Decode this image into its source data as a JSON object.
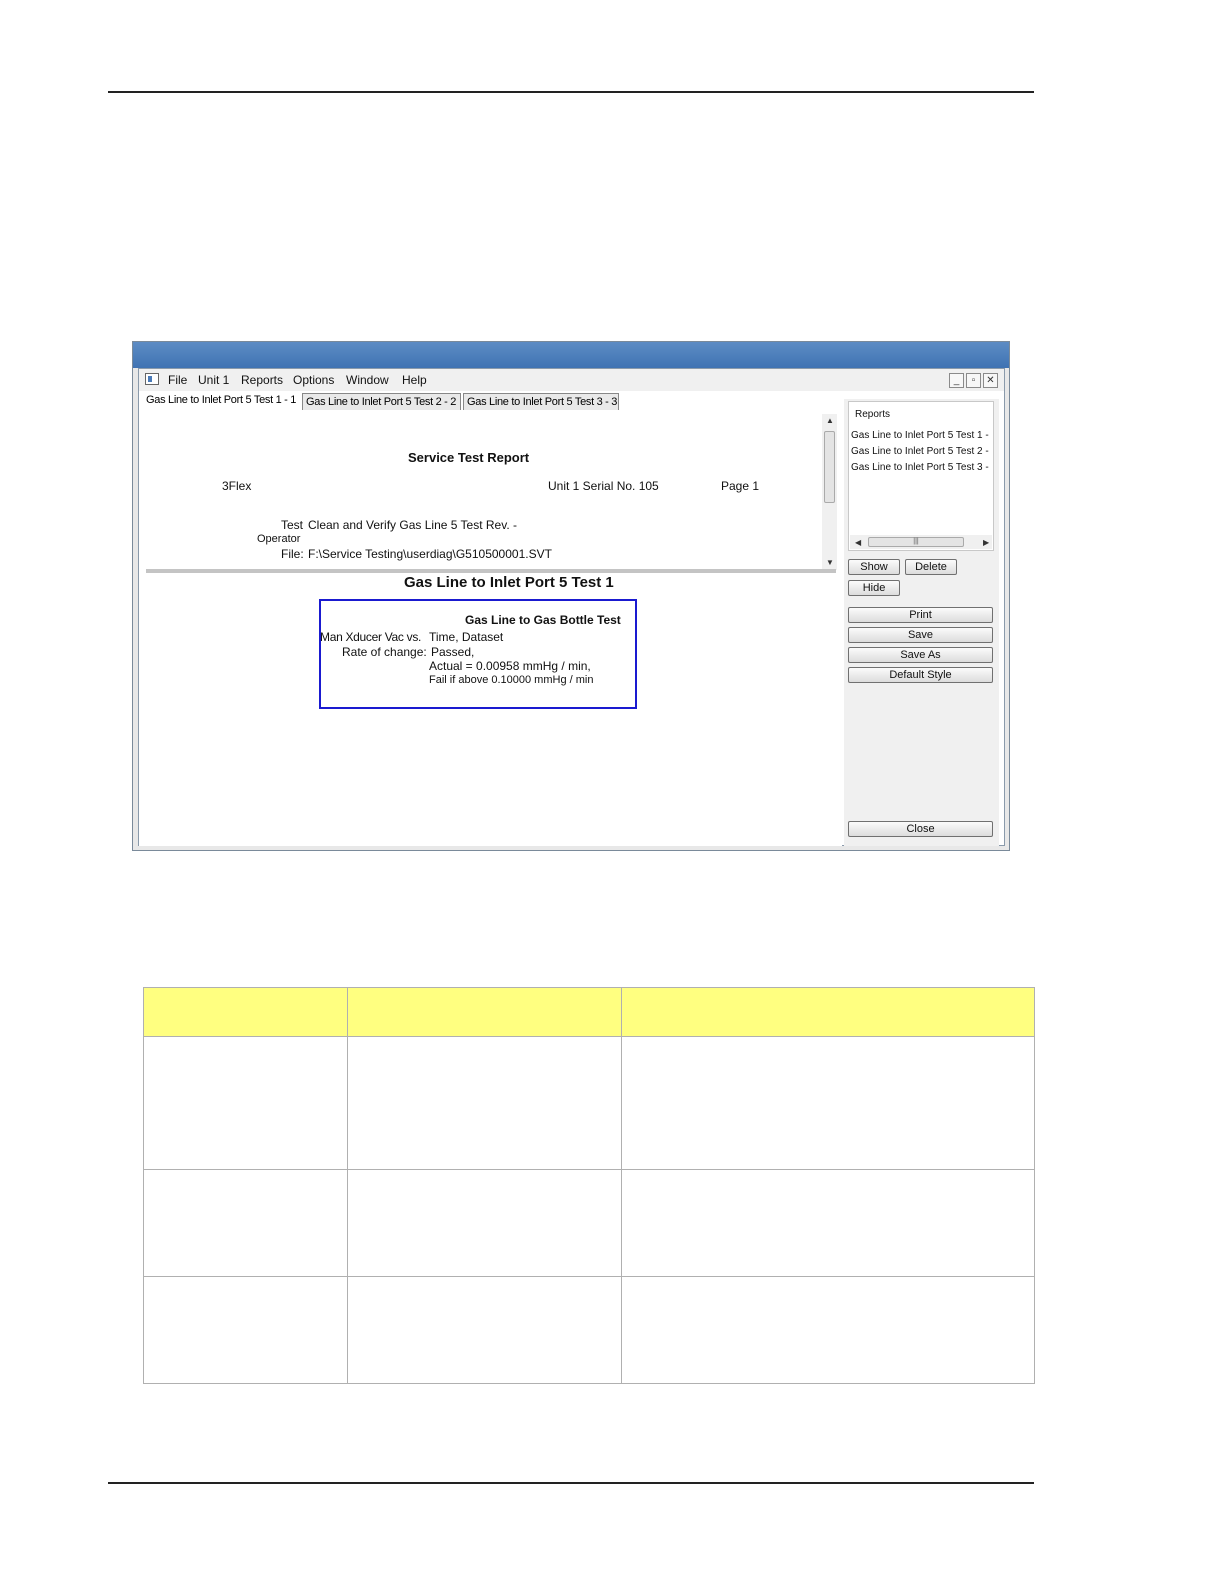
{
  "window": {
    "menu": [
      "File",
      "Unit 1",
      "Reports",
      "Options",
      "Window",
      "Help"
    ],
    "controls": [
      "_",
      "▫",
      "✕"
    ],
    "tabs": [
      "Gas Line to Inlet Port 5 Test 1 - 1",
      "Gas Line to Inlet Port 5 Test 2 - 2",
      "Gas Line to Inlet Port 5 Test 3 - 3"
    ]
  },
  "report": {
    "title": "Service Test Report",
    "instrument": "3Flex",
    "unit_serial": "Unit 1  Serial No. 105",
    "page": "Page 1",
    "test_label": "Test",
    "test_value": "Clean and Verify Gas Line 5 Test Rev. -",
    "operator_label": "Operator",
    "file_label": "File:",
    "file_value": "F:\\Service Testing\\userdiag\\G510500001.SVT",
    "section_title": "Gas Line to Inlet Port 5 Test 1",
    "box": {
      "title": "Gas Line to Gas Bottle Test",
      "row1_label": "Man Xducer Vac  vs.",
      "row1_value": "Time, Dataset",
      "row2_label": "Rate of change:",
      "row2_value": "Passed,",
      "actual": "Actual = 0.00958 mmHg / min,",
      "limit": "Fail if above 0.10000 mmHg / min"
    }
  },
  "sidebar": {
    "reports_label": "Reports",
    "reports": [
      "Gas Line to Inlet Port 5 Test 1 -",
      "Gas Line to Inlet Port 5 Test 2 -",
      "Gas Line to Inlet Port 5 Test 3 -"
    ],
    "show": "Show",
    "delete": "Delete",
    "hide": "Hide",
    "print": "Print",
    "save": "Save",
    "save_as": "Save As",
    "default_style": "Default Style",
    "close": "Close"
  }
}
